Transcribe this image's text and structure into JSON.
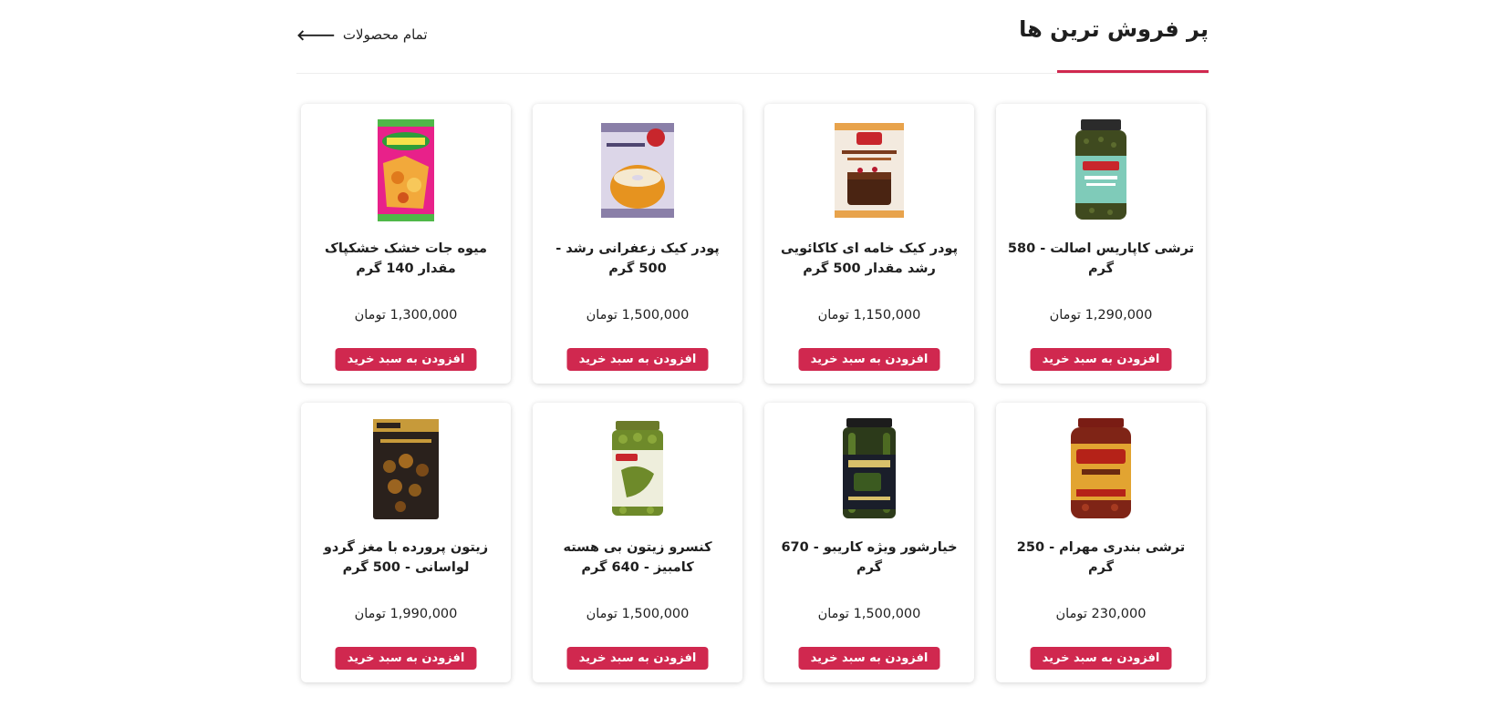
{
  "section": {
    "title": "پر فروش ترین ها",
    "all_link": "تمام محصولات",
    "accent": "#d0284f"
  },
  "products": [
    {
      "name": "ترشی کاپاریس اصالت - 580 گرم",
      "price": "1,290,000 تومان",
      "button": "افزودن به سبد خرید",
      "image": "caper-jar-image"
    },
    {
      "name": "پودر کیک خامه ای کاکائویی رشد مقدار 500 گرم",
      "price": "1,150,000 تومان",
      "button": "افزودن به سبد خرید",
      "image": "chocolate-cake-box-image"
    },
    {
      "name": "پودر کیک زعفرانی رشد - 500 گرم",
      "price": "1,500,000 تومان",
      "button": "افزودن به سبد خرید",
      "image": "saffron-cake-box-image"
    },
    {
      "name": "میوه جات خشک خشکپاک مقدار 140 گرم",
      "price": "1,300,000 تومان",
      "button": "افزودن به سبد خرید",
      "image": "dried-fruit-bag-image"
    },
    {
      "name": "ترشی بندری مهرام - 250 گرم",
      "price": "230,000 تومان",
      "button": "افزودن به سبد خرید",
      "image": "pickle-jar-image"
    },
    {
      "name": "خیارشور ویژه کاریبو - 670 گرم",
      "price": "1,500,000 تومان",
      "button": "افزودن به سبد خرید",
      "image": "cucumber-jar-image"
    },
    {
      "name": "کنسرو زیتون بی هسته کامبیز - 640 گرم",
      "price": "1,500,000 تومان",
      "button": "افزودن به سبد خرید",
      "image": "olive-jar-image"
    },
    {
      "name": "زیتون پرورده با مغز گردو لواسانی - 500 گرم",
      "price": "1,990,000 تومان",
      "button": "افزودن به سبد خرید",
      "image": "olive-pouch-image"
    }
  ]
}
